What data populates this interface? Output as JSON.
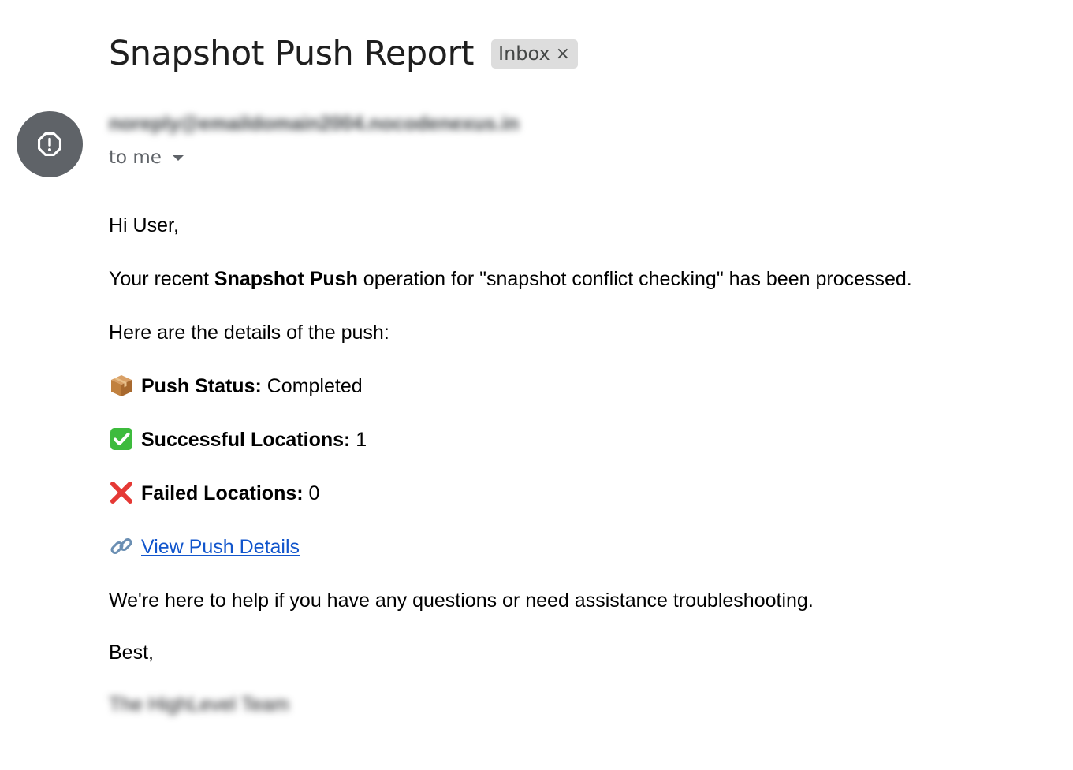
{
  "email": {
    "subject": "Snapshot Push Report",
    "label": "Inbox",
    "label_close": "×",
    "sender": "noreply@emaildomain2004.nocodenexus.in",
    "recipient": "to me",
    "avatar_icon": "alert-octagon-icon"
  },
  "body": {
    "greeting": "Hi User,",
    "intro_prefix": "Your recent ",
    "intro_bold": "Snapshot Push",
    "intro_suffix": " operation for \"snapshot conflict checking\" has been processed.",
    "details_intro": "Here are the details of the push:",
    "push_status_label": "Push Status:",
    "push_status_value": " Completed",
    "successful_label": "Successful Locations:",
    "successful_value": " 1",
    "failed_label": "Failed Locations:",
    "failed_value": " 0",
    "link_text": "View Push Details",
    "help_text": "We're here to help if you have any questions or need assistance troubleshooting.",
    "signoff": "Best,",
    "team": "The HighLevel Team"
  },
  "icons": {
    "package": "package-icon",
    "check": "check-mark-icon",
    "cross": "cross-mark-icon",
    "link": "link-icon"
  },
  "colors": {
    "link": "#1155cc",
    "avatar": "#5f6368",
    "chip": "#dddddd"
  }
}
